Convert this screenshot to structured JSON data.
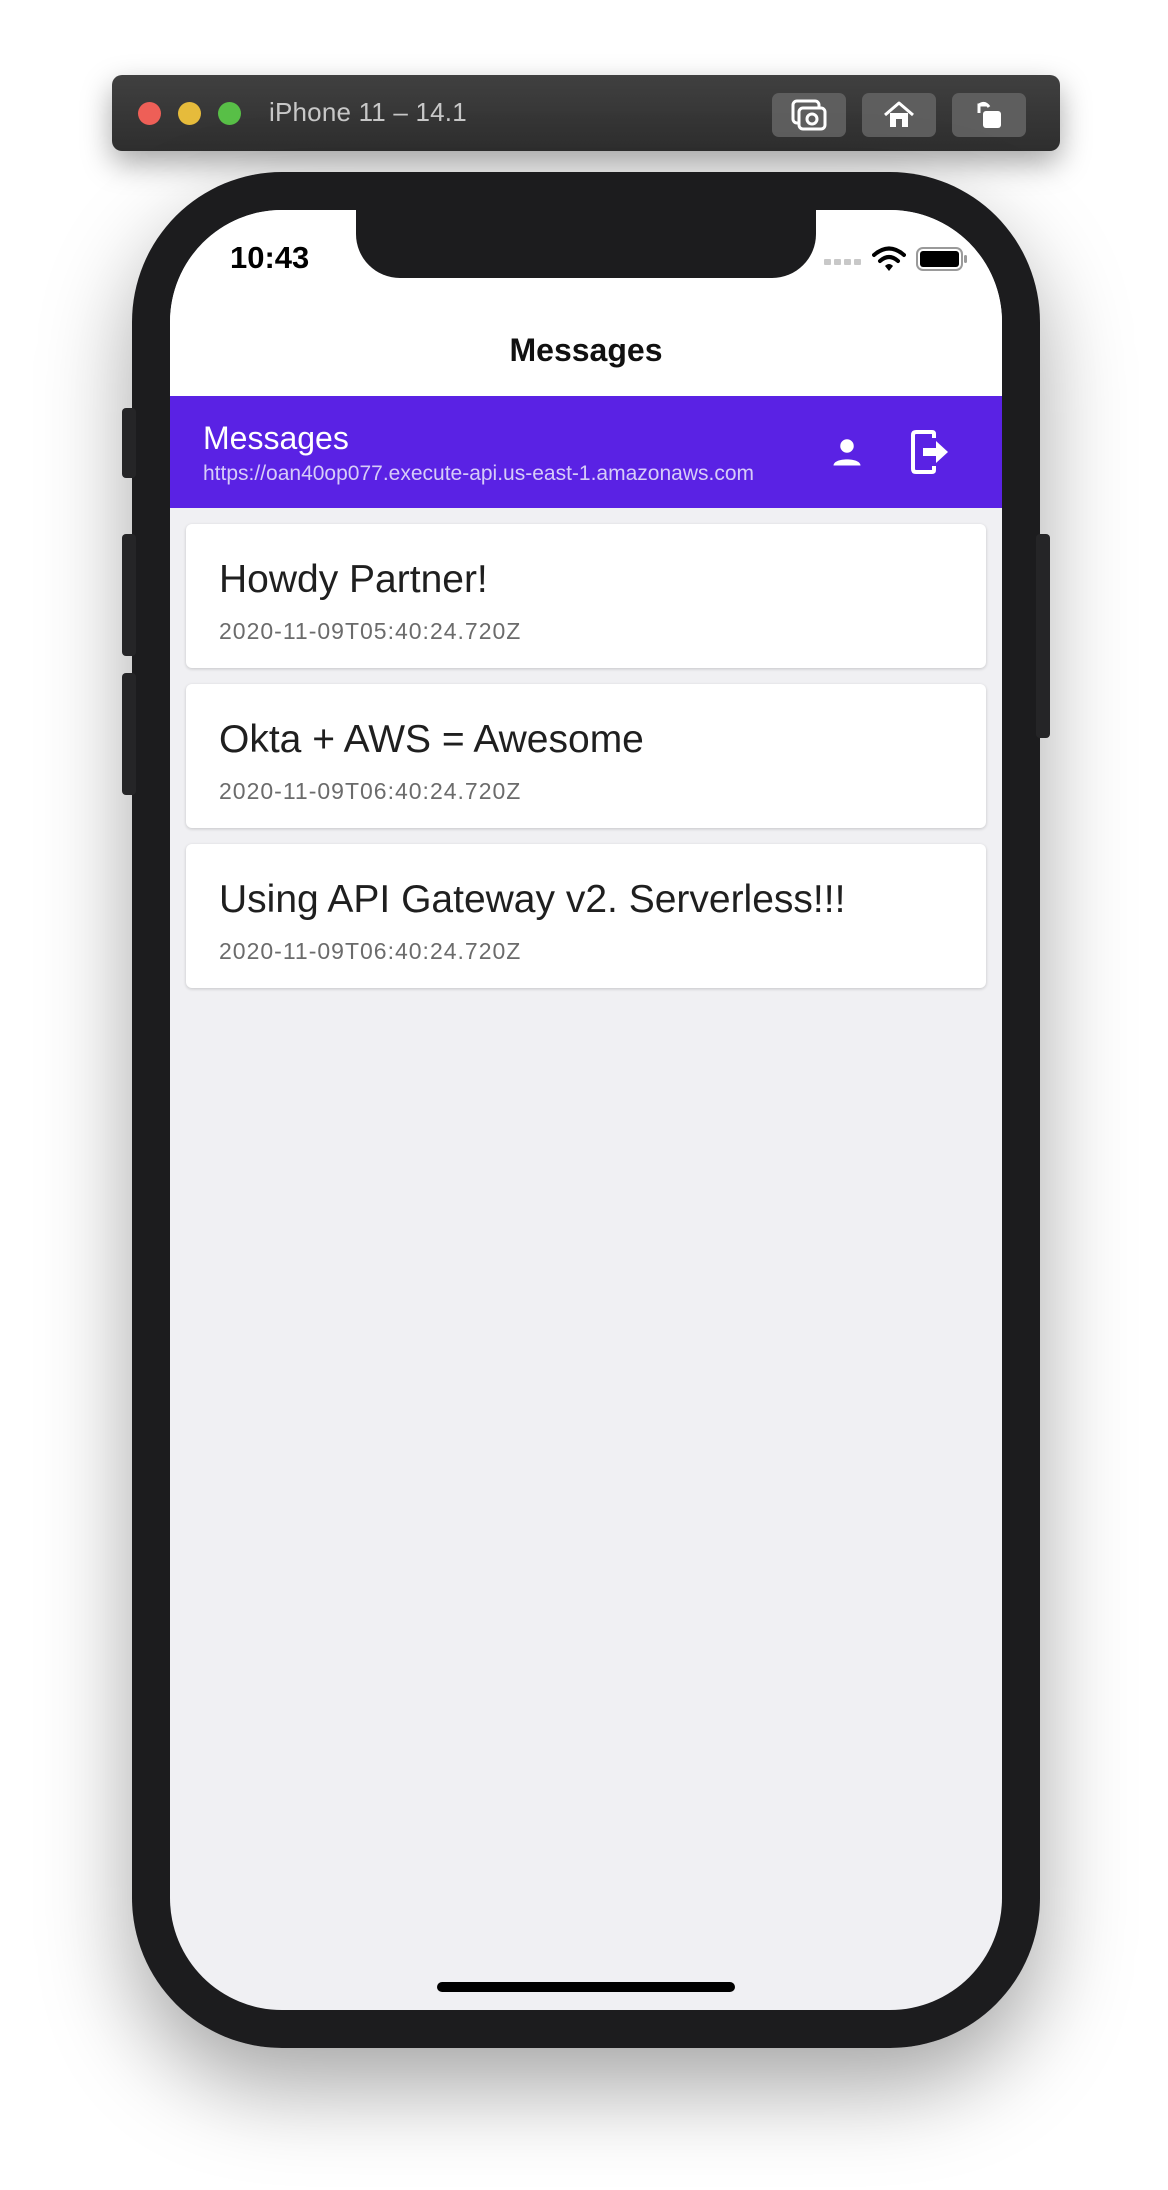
{
  "simulator": {
    "title": "iPhone 11 – 14.1"
  },
  "status_bar": {
    "time": "10:43"
  },
  "nav": {
    "title": "Messages"
  },
  "appbar": {
    "title": "Messages",
    "subtitle": "https://oan40op077.execute-api.us-east-1.amazonaws.com",
    "background": "#5a22e4"
  },
  "messages": [
    {
      "title": "Howdy Partner!",
      "date": "2020-11-09T05:40:24.720Z"
    },
    {
      "title": "Okta + AWS = Awesome",
      "date": "2020-11-09T06:40:24.720Z"
    },
    {
      "title": "Using API Gateway v2. Serverless!!!",
      "date": "2020-11-09T06:40:24.720Z"
    }
  ],
  "icons": {
    "screenshot": "camera-icon",
    "home": "home-icon",
    "rotate": "rotate-icon",
    "profile": "person-icon",
    "logout": "logout-icon"
  }
}
